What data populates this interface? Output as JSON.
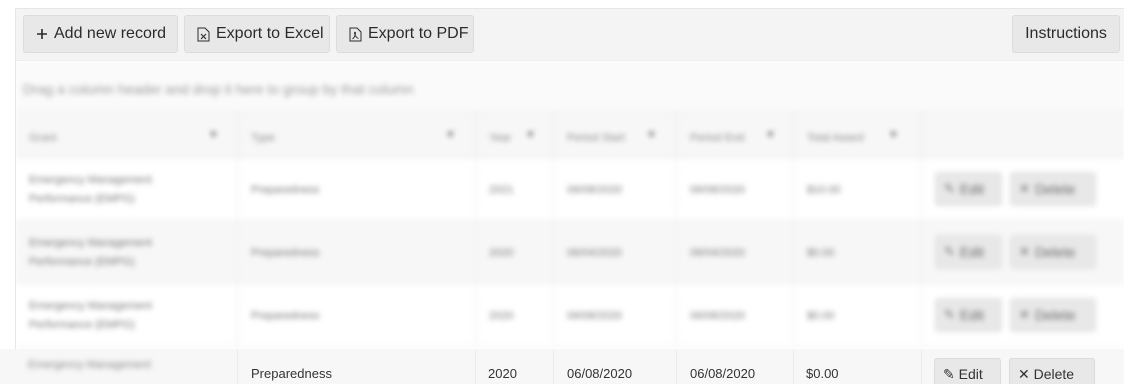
{
  "toolbar": {
    "add_label": "Add new record",
    "excel_label": "Export to Excel",
    "pdf_label": "Export to PDF",
    "instructions_label": "Instructions"
  },
  "grouping": {
    "hint": "Drag a column header and drop it here to group by that column"
  },
  "columns": [
    {
      "label": "Grant",
      "filterable": true
    },
    {
      "label": "Type",
      "filterable": true
    },
    {
      "label": "Year",
      "filterable": true
    },
    {
      "label": "Period Start",
      "filterable": true
    },
    {
      "label": "Period End",
      "filterable": true
    },
    {
      "label": "Total Award",
      "filterable": true
    },
    {
      "label": "",
      "filterable": false
    }
  ],
  "rows": [
    {
      "grant": "Emergency Management Performance (EMPG)",
      "type": "Preparedness",
      "year": "2021",
      "start": "06/08/2020",
      "end": "06/08/2020",
      "award": "$10.00",
      "edit": "Edit",
      "delete": "Delete"
    },
    {
      "grant": "Emergency Management Performance (EMPG)",
      "type": "Preparedness",
      "year": "2020",
      "start": "06/04/2020",
      "end": "06/04/2020",
      "award": "$0.00",
      "edit": "Edit",
      "delete": "Delete"
    },
    {
      "grant": "Emergency Management Performance (EMPG)",
      "type": "Preparedness",
      "year": "2020",
      "start": "06/08/2020",
      "end": "06/08/2020",
      "award": "$0.00",
      "edit": "Edit",
      "delete": "Delete"
    },
    {
      "grant": "Emergency Management",
      "type": "Preparedness",
      "year": "2020",
      "start": "06/08/2020",
      "end": "06/08/2020",
      "award": "$0.00",
      "edit": "Edit",
      "delete": "Delete"
    }
  ]
}
